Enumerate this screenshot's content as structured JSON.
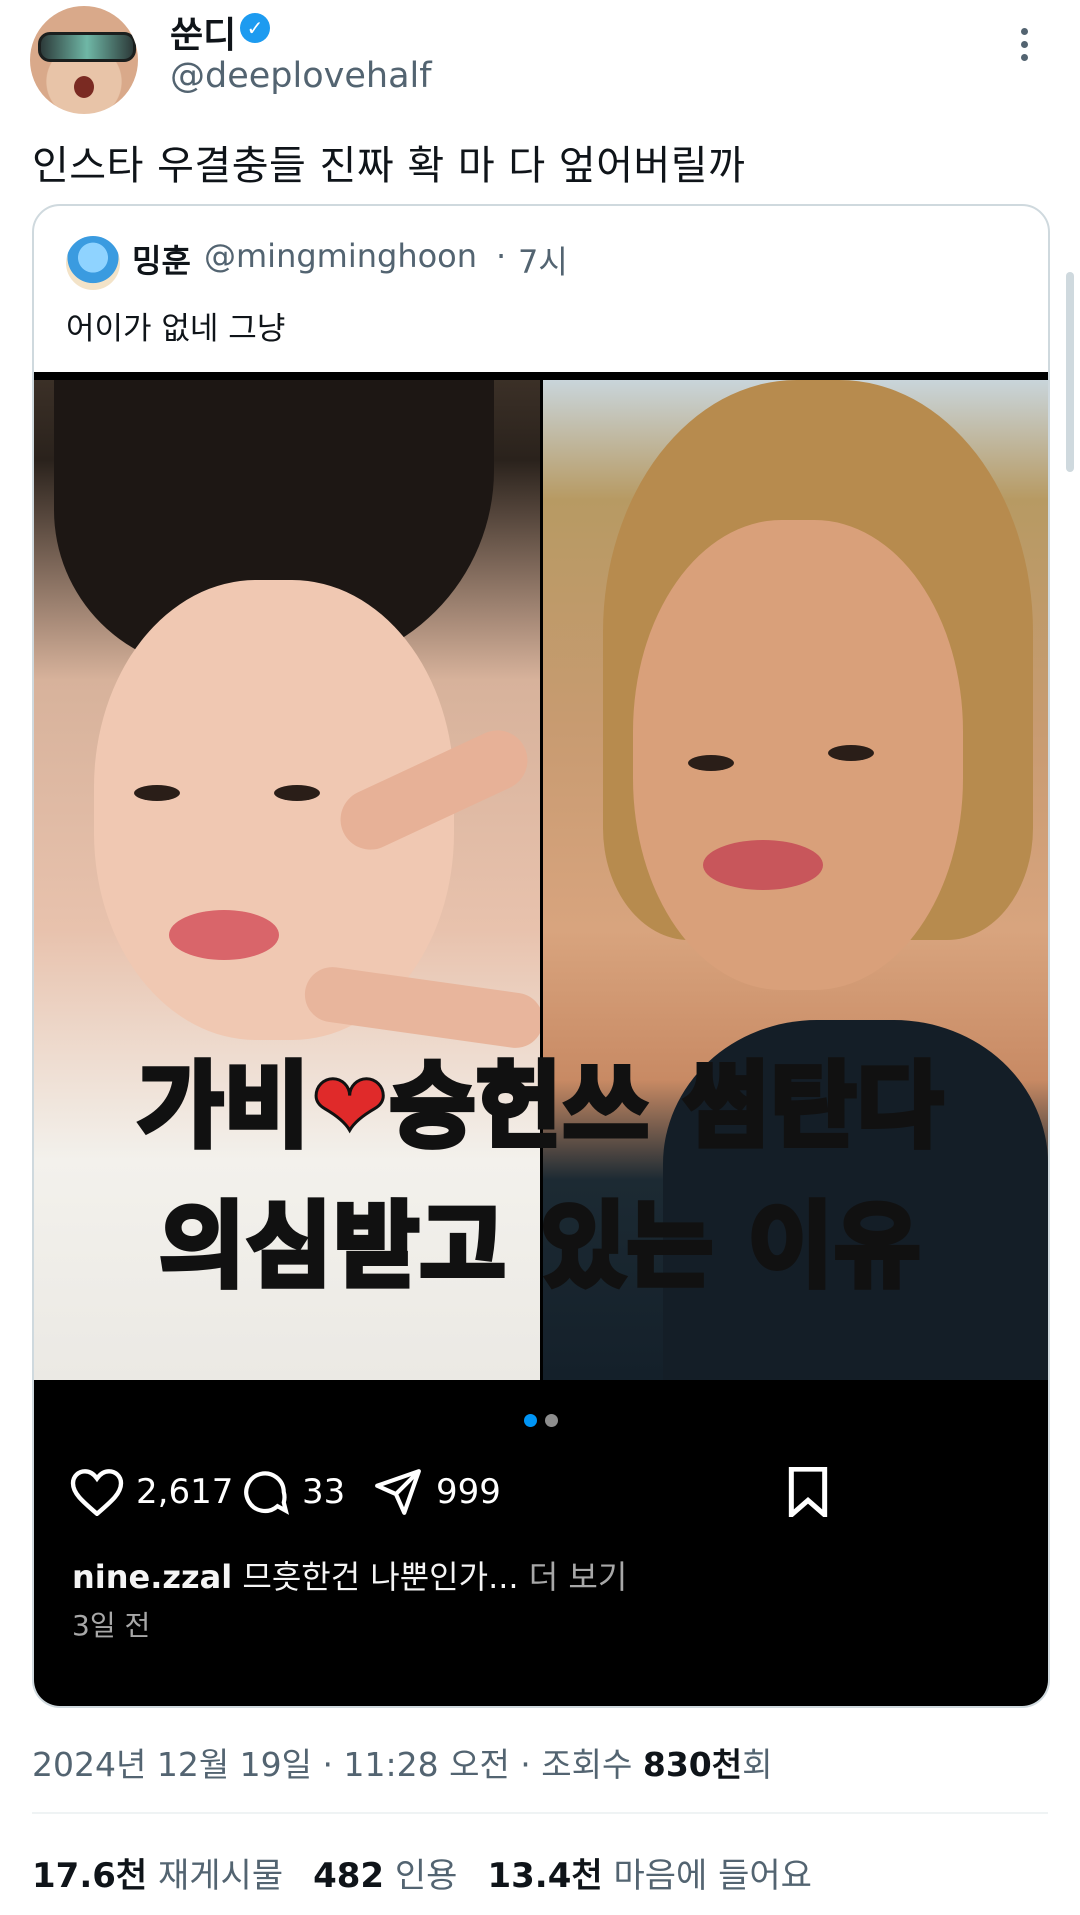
{
  "author": {
    "display_name": "쑨디",
    "handle": "@deeplovehalf",
    "verified_icon": "verified-badge-icon"
  },
  "tweet": {
    "text": "인스타 우결충들 진짜 확 마 다 엎어버릴까",
    "timestamp": "2024년 12월 19일 · 11:28 오전 · 조회수",
    "views_value": "830천",
    "views_suffix": "회"
  },
  "quote": {
    "display_name": "밍훈",
    "handle": "@mingminghoon",
    "separator": "·",
    "time": "7시",
    "text": "어이가 없네 그냥"
  },
  "media": {
    "caption_line1_a": "가비",
    "caption_heart": "❤",
    "caption_line1_b": "승헌쓰 썸탄다",
    "caption_line2": "의심받고 있는 이유",
    "carousel_pages": 2,
    "carousel_active": 1
  },
  "instagram": {
    "likes": "2,617",
    "comments": "33",
    "shares": "999",
    "caption_user": "nine.zzal",
    "caption_text": "므흣한건 나뿐인가...",
    "caption_more": "더 보기",
    "date": "3일 전"
  },
  "stats": {
    "reposts_value": "17.6천",
    "reposts_label": "재게시물",
    "quotes_value": "482",
    "quotes_label": "인용",
    "likes_value": "13.4천",
    "likes_label": "마음에 들어요"
  },
  "colors": {
    "accent": "#1d9bf0",
    "muted": "#536471",
    "media_bg": "#000000"
  }
}
